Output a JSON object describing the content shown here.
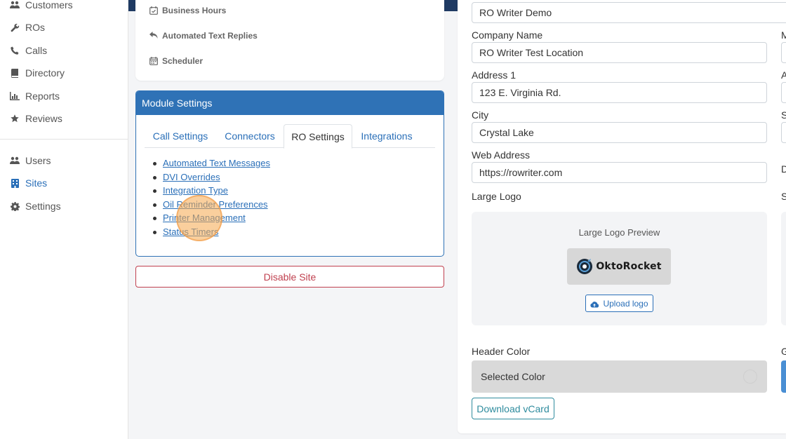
{
  "sidebar": {
    "items": [
      {
        "label": "Customers",
        "icon": "users-icon"
      },
      {
        "label": "ROs",
        "icon": "wrench-icon"
      },
      {
        "label": "Calls",
        "icon": "phone-icon"
      },
      {
        "label": "Directory",
        "icon": "book-icon"
      },
      {
        "label": "Reports",
        "icon": "chart-icon"
      },
      {
        "label": "Reviews",
        "icon": "star-icon"
      }
    ],
    "admin_items": [
      {
        "label": "Users",
        "icon": "users-icon"
      },
      {
        "label": "Sites",
        "icon": "building-icon",
        "active": true
      },
      {
        "label": "Settings",
        "icon": "gear-icon"
      }
    ]
  },
  "site_links": [
    {
      "label": "Business Hours",
      "icon": "calendar-check-icon"
    },
    {
      "label": "Automated Text Replies",
      "icon": "reply-icon"
    },
    {
      "label": "Scheduler",
      "icon": "calendar-icon"
    }
  ],
  "module_settings": {
    "title": "Module Settings",
    "tabs": [
      "Call Settings",
      "Connectors",
      "RO Settings",
      "Integrations"
    ],
    "active_tab": "RO Settings",
    "links": [
      "Automated Text Messages",
      "DVI Overrides",
      "Integration Type",
      "Oil Reminder Preferences",
      "Printer Management",
      "Status Timers"
    ]
  },
  "disable_site_label": "Disable Site",
  "site_form": {
    "site_name_value": "RO Writer Demo",
    "company_name_label": "Company Name",
    "company_name_value": "RO Writer Test Location",
    "address1_label": "Address 1",
    "address1_value": "123 E. Virginia Rd.",
    "city_label": "City",
    "city_value": "Crystal Lake",
    "web_address_label": "Web Address",
    "web_address_value": "https://rowriter.com",
    "large_logo_label": "Large Logo",
    "large_logo_preview_label": "Large Logo Preview",
    "logo_brand_text": "OktoRocket",
    "upload_logo_label": "Upload logo",
    "header_color_label": "Header Color",
    "selected_color_label": "Selected Color",
    "download_vcard_label": "Download vCard",
    "cut_labels": [
      "M",
      "A",
      "S",
      "D",
      "S",
      "G"
    ]
  },
  "colors": {
    "primary": "#2f72b6",
    "link": "#2a6fb8",
    "danger": "#c0404f",
    "nav_dark": "#1f3a63",
    "teal": "#2f8c9e",
    "header_color_preview": "#d9d9d9",
    "secondary_color_preview": "#4a8fd4"
  }
}
